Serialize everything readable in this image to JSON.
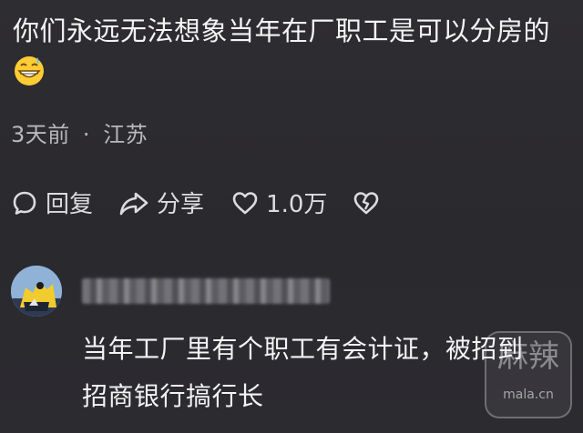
{
  "comment": {
    "text": "你们永远无法想象当年在厂职工是可以分房的",
    "emoji": "grinning-sweat-emoji",
    "time": "3天前",
    "separator": "·",
    "location": "江苏"
  },
  "actions": {
    "reply_label": "回复",
    "share_label": "分享",
    "like_count": "1.0万"
  },
  "reply": {
    "username": "",
    "text_line1": "当年工厂里有个职工有会计证，被招到",
    "text_line2": "招商银行搞行长"
  },
  "watermark": {
    "brand": "麻辣",
    "domain": "mala.cn"
  },
  "colors": {
    "background": "#2c2b30",
    "primary_text": "#f4f4f4",
    "secondary_text": "#b9b8bd"
  }
}
